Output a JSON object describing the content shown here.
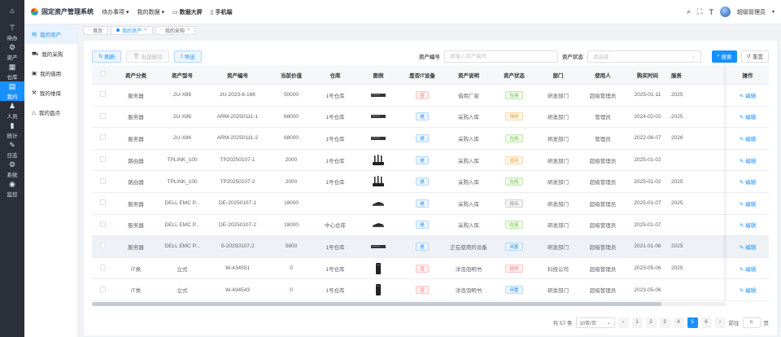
{
  "app": {
    "title": "固定资产管理系统",
    "user": "超级管理员"
  },
  "colors": {
    "accent": "#1890ff",
    "rail_bg": "#2b2f3a"
  },
  "top_nav": [
    {
      "label": "待办事项",
      "icon": "chevron-down-icon",
      "bold": false
    },
    {
      "label": "我的数据",
      "icon": "chevron-down-icon",
      "bold": false
    },
    {
      "label": "数据大屏",
      "icon": "monitor-icon",
      "bold": true
    },
    {
      "label": "手机端",
      "icon": "mobile-icon",
      "bold": true
    }
  ],
  "rail": [
    {
      "label": "",
      "icon": "home-icon",
      "glyph": "⌂"
    },
    {
      "label": "待办",
      "icon": "todo-icon",
      "glyph": "⊤"
    },
    {
      "label": "资产",
      "icon": "asset-icon",
      "glyph": "⚙"
    },
    {
      "label": "仓库",
      "icon": "warehouse-icon",
      "glyph": "▦"
    },
    {
      "label": "我的",
      "icon": "my-icon",
      "glyph": "▤",
      "active": true
    },
    {
      "label": "人员",
      "icon": "people-icon",
      "glyph": "♟"
    },
    {
      "label": "统计",
      "icon": "stats-icon",
      "glyph": "▮"
    },
    {
      "label": "日志",
      "icon": "log-icon",
      "glyph": "✎"
    },
    {
      "label": "系统",
      "icon": "system-gear-icon",
      "glyph": "⚙"
    },
    {
      "label": "监控",
      "icon": "monitor-eye-icon",
      "glyph": "◉"
    }
  ],
  "side2": [
    {
      "label": "我的资产",
      "icon": "my-asset-icon",
      "glyph": "▤",
      "active": true
    },
    {
      "label": "我的采购",
      "icon": "cart-icon",
      "glyph": "⛟"
    },
    {
      "label": "我的借用",
      "icon": "borrow-icon",
      "glyph": "▣"
    },
    {
      "label": "我的维保",
      "icon": "repair-icon",
      "glyph": "⚒"
    },
    {
      "label": "我的盘点",
      "icon": "inventory-icon",
      "glyph": "△"
    }
  ],
  "tabs": [
    {
      "label": "首页",
      "active": false,
      "closable": false
    },
    {
      "label": "我的资产",
      "active": true,
      "closable": true
    },
    {
      "label": "我的采购",
      "active": false,
      "closable": true
    }
  ],
  "toolbar": {
    "refresh": "刷新",
    "batch_delete": "批量删除",
    "export": "导出",
    "asset_no_label": "资产编号",
    "asset_no_placeholder": "请输入资产编号",
    "status_label": "资产状态",
    "status_placeholder": "请选择",
    "search": "搜索",
    "reset": "重置"
  },
  "table": {
    "columns": [
      "",
      "资产分类",
      "资产型号",
      "资产编号",
      "当前价值",
      "仓库",
      "图例",
      "是否IT设备",
      "资产说明",
      "资产状态",
      "部门",
      "使用人",
      "购买时间",
      "服务"
    ],
    "op_header": "操作",
    "edit_label": "编辑",
    "badge_styles": {
      "red": {
        "color": "#f56c6c",
        "bg": "#fef0f0",
        "border": "#fbc4c4"
      },
      "blue": {
        "color": "#1890ff",
        "bg": "#ecf5ff",
        "border": "#b3d8ff"
      },
      "green": {
        "color": "#67c23a",
        "bg": "#f0f9eb",
        "border": "#c2e7b0"
      },
      "orange": {
        "color": "#e6a23c",
        "bg": "#fdf6ec",
        "border": "#f5dab1"
      },
      "grey": {
        "color": "#909399",
        "bg": "#f4f4f5",
        "border": "#d3d4d6"
      }
    },
    "rows": [
      {
        "category": "服务器",
        "model": "2U-X86",
        "asset_no": "2U-2023-8-166",
        "value": "50000",
        "warehouse": "1号仓库",
        "legend": "server-rack",
        "is_it": "否",
        "is_it_style": "red",
        "desc": "借用厂家",
        "status": "在用",
        "status_style": "green",
        "dept": "研发部门",
        "user": "超级管理员",
        "purchase": "2025-01-11",
        "extra": "2025"
      },
      {
        "category": "服务器",
        "model": "2U-X86",
        "asset_no": "ARM-20250111-1",
        "value": "68000",
        "warehouse": "1号仓库",
        "legend": "server-rack",
        "is_it": "是",
        "is_it_style": "blue",
        "desc": "采购入库",
        "status": "维修",
        "status_style": "orange",
        "dept": "研发部门",
        "user": "管理员",
        "purchase": "2024-02-02",
        "extra": "2025"
      },
      {
        "category": "服务器",
        "model": "2U-X86",
        "asset_no": "ARM-20250111-2",
        "value": "68000",
        "warehouse": "1号仓库",
        "legend": "server-rack",
        "is_it": "是",
        "is_it_style": "blue",
        "desc": "采购入库",
        "status": "在用",
        "status_style": "green",
        "dept": "研发部门",
        "user": "管理员",
        "purchase": "2022-06-07",
        "extra": "2026"
      },
      {
        "category": "路由器",
        "model": "TPLINK_100",
        "asset_no": "TP20250107-1",
        "value": "2000",
        "warehouse": "1号仓库",
        "legend": "router-antenna",
        "is_it": "是",
        "is_it_style": "blue",
        "desc": "采购入库",
        "status": "借用",
        "status_style": "orange",
        "dept": "研发部门",
        "user": "超级管理员",
        "purchase": "2025-01-02",
        "extra": ""
      },
      {
        "category": "路由器",
        "model": "TPLINK_100",
        "asset_no": "TP20250107-2",
        "value": "2000",
        "warehouse": "1号仓库",
        "legend": "router-antenna",
        "is_it": "是",
        "is_it_style": "blue",
        "desc": "采购入库",
        "status": "在用",
        "status_style": "green",
        "dept": "研发部门",
        "user": "超级管理员",
        "purchase": "2025-01-02",
        "extra": "2025"
      },
      {
        "category": "服务器",
        "model": "DELL EMC P...",
        "asset_no": "DE-20250107-1",
        "value": "18000",
        "warehouse": "",
        "legend": "router-small",
        "is_it": "是",
        "is_it_style": "blue",
        "desc": "采购入库",
        "status": "报出",
        "status_style": "grey",
        "dept": "研发部门",
        "user": "超级管理员",
        "purchase": "2025-01-07",
        "extra": "2025"
      },
      {
        "category": "服务器",
        "model": "DELL EMC P...",
        "asset_no": "DE-20250107-2",
        "value": "18000",
        "warehouse": "中心仓库",
        "legend": "router-small",
        "is_it": "是",
        "is_it_style": "blue",
        "desc": "采购入库",
        "status": "在用",
        "status_style": "green",
        "dept": "研发部门",
        "user": "超级管理员",
        "purchase": "2025-01-07",
        "extra": ""
      },
      {
        "category": "服务器",
        "model": "DELL EMC P...",
        "asset_no": "S-20250107-2",
        "value": "5800",
        "warehouse": "1号仓库",
        "legend": "server-rack",
        "is_it": "是",
        "is_it_style": "blue",
        "desc": "正在使用的设备",
        "status": "闲置",
        "status_style": "blue",
        "dept": "研发部门",
        "user": "超级管理员",
        "purchase": "2021-01-06",
        "extra": "2025",
        "highlight": true
      },
      {
        "category": "IT类",
        "model": "立式",
        "asset_no": "W-434551",
        "value": "0",
        "warehouse": "1号仓库",
        "legend": "tower-pc",
        "is_it": "否",
        "is_it_style": "red",
        "desc": "洋泡泡明书",
        "status": "损坏",
        "status_style": "red",
        "dept": "科技公司",
        "user": "超级管理员",
        "purchase": "2023-05-06",
        "extra": "2025"
      },
      {
        "category": "IT类",
        "model": "立式",
        "asset_no": "W-434543",
        "value": "0",
        "warehouse": "1号仓库",
        "legend": "tower-pc",
        "is_it": "否",
        "is_it_style": "red",
        "desc": "洋泡泡明书",
        "status": "闲置",
        "status_style": "blue",
        "dept": "研发部门",
        "user": "超级管理员",
        "purchase": "2023-05-06",
        "extra": ""
      }
    ]
  },
  "pagination": {
    "total": "共 57 条",
    "page_size": "10条/页",
    "pages": [
      "1",
      "2",
      "3",
      "4",
      "5",
      "6"
    ],
    "current": "5",
    "goto_label": "前往",
    "goto_value": "5",
    "page_unit": "页"
  }
}
